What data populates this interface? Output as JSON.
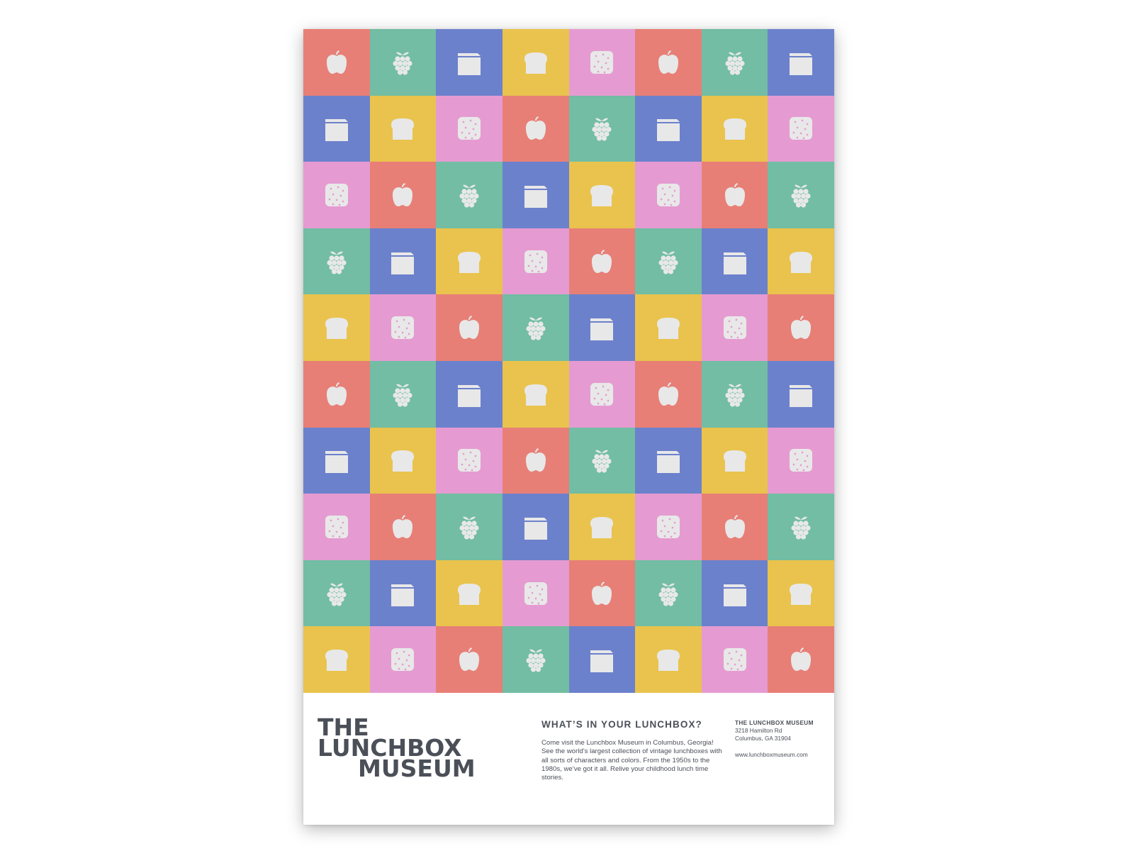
{
  "colors": {
    "red": "#e77f76",
    "green": "#72bda3",
    "blue": "#6c81cc",
    "yellow": "#e9c34d",
    "pink": "#e59bd1",
    "icon": "#e8e8e8",
    "ink": "#4b4f58"
  },
  "pattern": {
    "sequence": [
      {
        "color": "red",
        "icon": "apple-icon"
      },
      {
        "color": "green",
        "icon": "grapes-icon"
      },
      {
        "color": "blue",
        "icon": "juice-box-icon"
      },
      {
        "color": "yellow",
        "icon": "bread-icon"
      },
      {
        "color": "pink",
        "icon": "cracker-icon"
      }
    ],
    "rows": 10,
    "columns": 8
  },
  "logo": {
    "line1": "THE",
    "line2": "LUNCHBOX",
    "line3": "MUSEUM"
  },
  "headline": "WHAT’S IN YOUR LUNCHBOX?",
  "body": "Come visit the Lunchbox Museum in Columbus, Georgia! See the world’s largest collection of vintage lunchboxes with all sorts of characters and colors. From the 1950s to the 1980s, we’ve got it all. Relive your childhood lunch time stories.",
  "info": {
    "name": "THE LUNCHBOX MUSEUM",
    "address1": "3218 Hamilton Rd",
    "address2": "Columbus, GA 31904",
    "website": "www.lunchboxmuseum.com"
  }
}
